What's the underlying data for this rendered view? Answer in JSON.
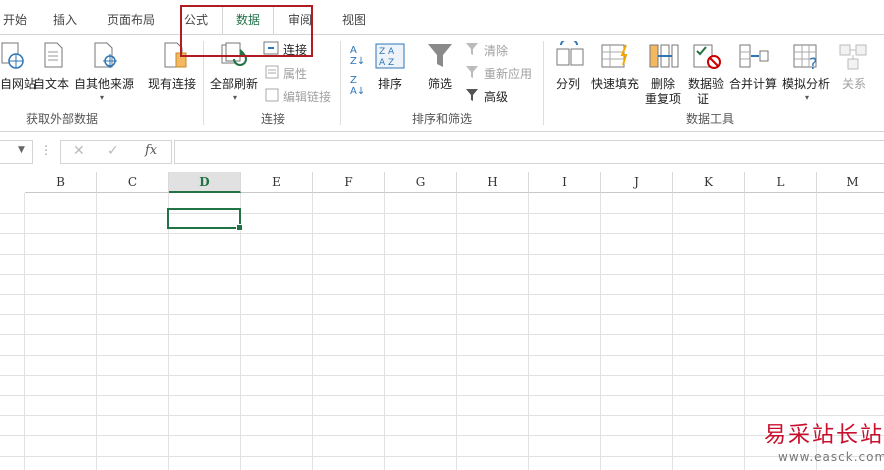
{
  "tabs": [
    "开始",
    "插入",
    "页面布局",
    "公式",
    "数据",
    "审阅",
    "视图"
  ],
  "ribbon": {
    "web": "自网站",
    "text": "自文本",
    "other": "自其他来源",
    "existing": "现有连接",
    "refresh_all": "全部刷新",
    "connections": "连接",
    "properties": "属性",
    "edit_links": "编辑链接",
    "sort": "排序",
    "filter": "筛选",
    "clear": "清除",
    "reapply": "重新应用",
    "advanced": "高级",
    "text_to_cols": "分列",
    "flash_fill": "快速填充",
    "remove_dup_1": "删除",
    "remove_dup_2": "重复项",
    "validation_1": "数据验",
    "validation_2": "证",
    "consolidate": "合并计算",
    "whatif": "模拟分析",
    "relations": "关系",
    "group_get_external": "获取外部数据",
    "group_connections": "连接",
    "group_sort_filter": "排序和筛选",
    "group_data_tools": "数据工具"
  },
  "formula_bar": {
    "fx": "fx",
    "content": ""
  },
  "columns": [
    "B",
    "C",
    "D",
    "E",
    "F",
    "G",
    "H",
    "I",
    "J",
    "K",
    "L",
    "M"
  ],
  "selected_column": "D",
  "watermark": {
    "brand": "易采站长站",
    "url": "www.easck.com"
  }
}
